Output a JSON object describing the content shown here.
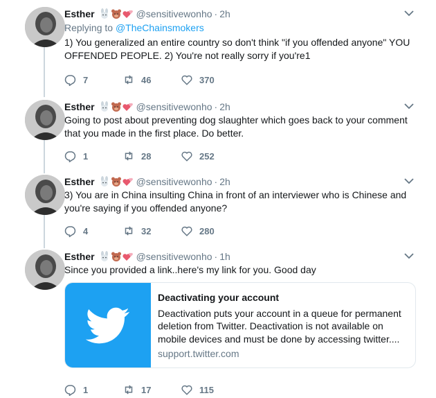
{
  "tweets": [
    {
      "name": "Esther",
      "handle": "@sensitivewonho",
      "time": "2h",
      "replying_prefix": "Replying to ",
      "replying_to": "@TheChainsmokers",
      "text": "1) You generalized an entire country so don't think \"if you offended anyone\" YOU OFFENDED PEOPLE. 2) You're not really sorry if you're1",
      "replies": "7",
      "retweets": "46",
      "likes": "370"
    },
    {
      "name": "Esther",
      "handle": "@sensitivewonho",
      "time": "2h",
      "text": "Going to post about preventing dog slaughter which goes back to your comment that you made in the first place. Do better.",
      "replies": "1",
      "retweets": "28",
      "likes": "252"
    },
    {
      "name": "Esther",
      "handle": "@sensitivewonho",
      "time": "2h",
      "text": "3) You are in China insulting China in front of an interviewer who is Chinese and you're saying if you offended anyone?",
      "replies": "4",
      "retweets": "32",
      "likes": "280"
    },
    {
      "name": "Esther",
      "handle": "@sensitivewonho",
      "time": "1h",
      "text": "Since you provided a link..here's my link for you. Good day",
      "replies": "1",
      "retweets": "17",
      "likes": "115",
      "card": {
        "title": "Deactivating your account",
        "description": "Deactivation puts your account in a queue for permanent deletion from Twitter. Deactivation is not available on mobile devices and must be done by accessing twitter....",
        "domain": "support.twitter.com"
      }
    }
  ],
  "icons": {
    "reply": "reply-icon",
    "retweet": "retweet-icon",
    "like": "like-icon",
    "caret": "chevron-down-icon",
    "emojis": [
      "rabbit-face-icon",
      "bear-face-icon",
      "two-hearts-icon"
    ]
  },
  "colors": {
    "accent": "#1da1f2",
    "secondary_text": "#657786",
    "border": "#e1e8ed"
  }
}
